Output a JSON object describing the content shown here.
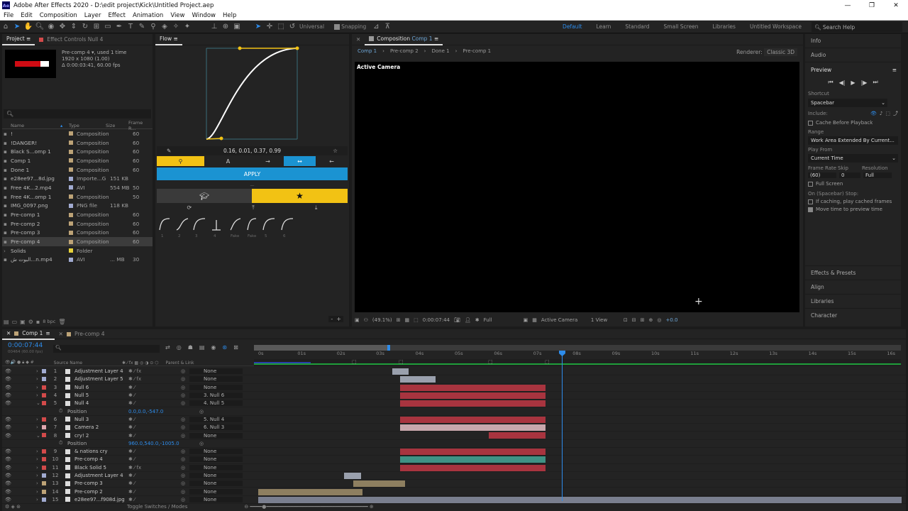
{
  "titlebar": {
    "title": "Adobe After Effects 2020 - D:\\edit project\\Kick\\Untitled Project.aep",
    "logo": "Ae"
  },
  "menu": [
    "File",
    "Edit",
    "Composition",
    "Layer",
    "Effect",
    "Animation",
    "View",
    "Window",
    "Help"
  ],
  "toolbar": {
    "universal": "Universal",
    "snapping": "Snapping",
    "workspaces": [
      "Default",
      "Learn",
      "Standard",
      "Small Screen",
      "Libraries",
      "Untitled Workspace"
    ],
    "search": "Search Help"
  },
  "project": {
    "tab": "Project",
    "tab2": "Effect Controls Null 4",
    "selected_name": "Pre-comp 4",
    "used": ", used 1 time",
    "dims": "1920 x 1080 (1.00)",
    "duration": "Δ 0:00:03:41, 60.00 fps",
    "cols": {
      "name": "Name",
      "type": "Type",
      "size": "Size",
      "fps": "Frame R..."
    },
    "items": [
      {
        "name": "!",
        "type": "Composition",
        "size": "",
        "fps": "60",
        "color": "#bda377"
      },
      {
        "name": "!DANGER!",
        "type": "Composition",
        "size": "",
        "fps": "60",
        "color": "#bda377"
      },
      {
        "name": "Black S...omp 1",
        "type": "Composition",
        "size": "",
        "fps": "60",
        "color": "#bda377"
      },
      {
        "name": "Comp 1",
        "type": "Composition",
        "size": "",
        "fps": "60",
        "color": "#bda377"
      },
      {
        "name": "Done 1",
        "type": "Composition",
        "size": "",
        "fps": "60",
        "color": "#bda377"
      },
      {
        "name": "e28ee97...8d.jpg",
        "type": "Importe...G",
        "size": "151 KB",
        "fps": "",
        "color": "#a1abd1"
      },
      {
        "name": "Free 4K...2.mp4",
        "type": "AVI",
        "size": "554 MB",
        "fps": "50",
        "color": "#a1abd1"
      },
      {
        "name": "Free 4K...omp 1",
        "type": "Composition",
        "size": "",
        "fps": "50",
        "color": "#bda377"
      },
      {
        "name": "IMG_0097.png",
        "type": "PNG file",
        "size": "118 KB",
        "fps": "",
        "color": "#a1abd1"
      },
      {
        "name": "Pre-comp 1",
        "type": "Composition",
        "size": "",
        "fps": "60",
        "color": "#bda377"
      },
      {
        "name": "Pre-comp 2",
        "type": "Composition",
        "size": "",
        "fps": "60",
        "color": "#bda377"
      },
      {
        "name": "Pre-comp 3",
        "type": "Composition",
        "size": "",
        "fps": "60",
        "color": "#bda377"
      },
      {
        "name": "Pre-comp 4",
        "type": "Composition",
        "size": "",
        "fps": "60",
        "color": "#bda377",
        "selected": true
      },
      {
        "name": "Solids",
        "type": "Folder",
        "size": "",
        "fps": "",
        "color": "#e6d23a",
        "folder": true
      },
      {
        "name": "البوت ش...n.mp4",
        "type": "AVI",
        "size": "... MB",
        "fps": "30",
        "color": "#a1abd1"
      }
    ],
    "bpc": "8 bpc"
  },
  "flow": {
    "tab": "Flow",
    "values": "0.16, 0.01, 0.37, 0.99",
    "apply": "APPLY",
    "presets": [
      "1",
      "2",
      "3",
      "4",
      "Fake",
      "Fake",
      "5",
      "6"
    ]
  },
  "comp": {
    "tab": "Composition",
    "tab_name": "Comp 1",
    "breadcrumbs": [
      "Comp 1",
      "Pre-comp 2",
      "Done 1",
      "Pre-comp 1"
    ],
    "renderer_label": "Renderer:",
    "renderer": "Classic 3D",
    "active_camera": "Active Camera",
    "footer": {
      "zoom": "(49.1%)",
      "time": "0:00:07:44",
      "res": "Full",
      "camera": "Active Camera",
      "view": "1 View",
      "exposure": "+0.0"
    }
  },
  "right": {
    "info": "Info",
    "audio": "Audio",
    "preview": "Preview",
    "shortcut_label": "Shortcut",
    "shortcut": "Spacebar",
    "include": "Include:",
    "cache": "Cache Before Playback",
    "range_label": "Range",
    "range": "Work Area Extended By Current...",
    "playfrom_label": "Play From",
    "playfrom": "Current Time",
    "fr_label": "Frame Rate",
    "skip_label": "Skip",
    "res_label": "Resolution",
    "fr": "(60)",
    "skip": "0",
    "res": "Full",
    "fullscreen": "Full Screen",
    "stop_label": "On (Spacebar) Stop:",
    "stop1": "If caching, play cached frames",
    "stop2": "Move time to preview time",
    "panels": [
      "Effects & Presets",
      "Align",
      "Libraries",
      "Character"
    ]
  },
  "timeline": {
    "tabs": [
      "Comp 1",
      "Pre-comp 4"
    ],
    "time": "0:00:07:44",
    "frames": "00464 (60.00 fps)",
    "hdr": {
      "source": "Source Name",
      "parent": "Parent & Link"
    },
    "ruler": [
      "0s",
      "01s",
      "02s",
      "03s",
      "04s",
      "05s",
      "06s",
      "07s",
      "08s",
      "09s",
      "10s",
      "11s",
      "12s",
      "13s",
      "14s",
      "15s",
      "16s"
    ],
    "layers": [
      {
        "n": "1",
        "name": "Adjustment Layer 4",
        "color": "#a1abd1",
        "parent": "None",
        "bar": [
          550,
          573
        ],
        "bcol": "#9aa0ad",
        "fx": true
      },
      {
        "n": "2",
        "name": "Adjustment Layer 5",
        "color": "#a1abd1",
        "parent": "None",
        "bar": [
          561,
          611
        ],
        "bcol": "#9aa0ad",
        "fx": true
      },
      {
        "n": "3",
        "name": "Null 6",
        "color": "#d34a4a",
        "parent": "None",
        "bar": [
          561,
          766
        ],
        "bcol": "#a8343f"
      },
      {
        "n": "4",
        "name": "Null 5",
        "color": "#d34a4a",
        "parent": "3. Null 6",
        "bar": [
          561,
          766
        ],
        "bcol": "#a8343f"
      },
      {
        "n": "5",
        "name": "Null 4",
        "color": "#d34a4a",
        "parent": "4. Null 5",
        "bar": [
          561,
          766
        ],
        "bcol": "#a8343f",
        "open": true
      },
      {
        "prop": "Position",
        "val": "0.0,0.0,-547.0"
      },
      {
        "n": "6",
        "name": "Null 3",
        "color": "#d34a4a",
        "parent": "5. Null 4",
        "bar": [
          561,
          766
        ],
        "bcol": "#a8343f"
      },
      {
        "n": "7",
        "name": "Camera 2",
        "color": "#e0a8b0",
        "parent": "6. Null 3",
        "bar": [
          561,
          766
        ],
        "bcol": "#c8a7ac"
      },
      {
        "n": "8",
        "name": "cry! 2",
        "color": "#d34a4a",
        "parent": "None",
        "bar": [
          686,
          766
        ],
        "bcol": "#a8343f",
        "open": true
      },
      {
        "prop": "Position",
        "val": "960.0,540.0,-1005.0"
      },
      {
        "n": "9",
        "name": "& nations cry",
        "color": "#d34a4a",
        "parent": "None",
        "bar": [
          561,
          766
        ],
        "bcol": "#a8343f"
      },
      {
        "n": "10",
        "name": "Pre-comp 4",
        "color": "#d34a4a",
        "parent": "None",
        "bar": [
          561,
          766
        ],
        "bcol": "#3f9285"
      },
      {
        "n": "11",
        "name": "Black Solid 5",
        "color": "#d34a4a",
        "parent": "None",
        "bar": [
          561,
          766
        ],
        "bcol": "#a8343f",
        "fx": true
      },
      {
        "n": "12",
        "name": "Adjustment Layer 4",
        "color": "#a1abd1",
        "parent": "None",
        "bar": [
          482,
          506
        ],
        "bcol": "#9aa0ad"
      },
      {
        "n": "13",
        "name": "Pre-comp 3",
        "color": "#bda377",
        "parent": "None",
        "bar": [
          495,
          568
        ],
        "bcol": "#8e7f60"
      },
      {
        "n": "14",
        "name": "Pre-comp 2",
        "color": "#bda377",
        "parent": "None",
        "bar": [
          361,
          508
        ],
        "bcol": "#8e7f60"
      },
      {
        "n": "15",
        "name": "e28ee97...f908d.jpg",
        "color": "#a1abd1",
        "parent": "None",
        "bar": [
          361,
          1268
        ],
        "bcol": "#7a7f8f"
      }
    ],
    "footer": "Toggle Switches / Modes"
  }
}
